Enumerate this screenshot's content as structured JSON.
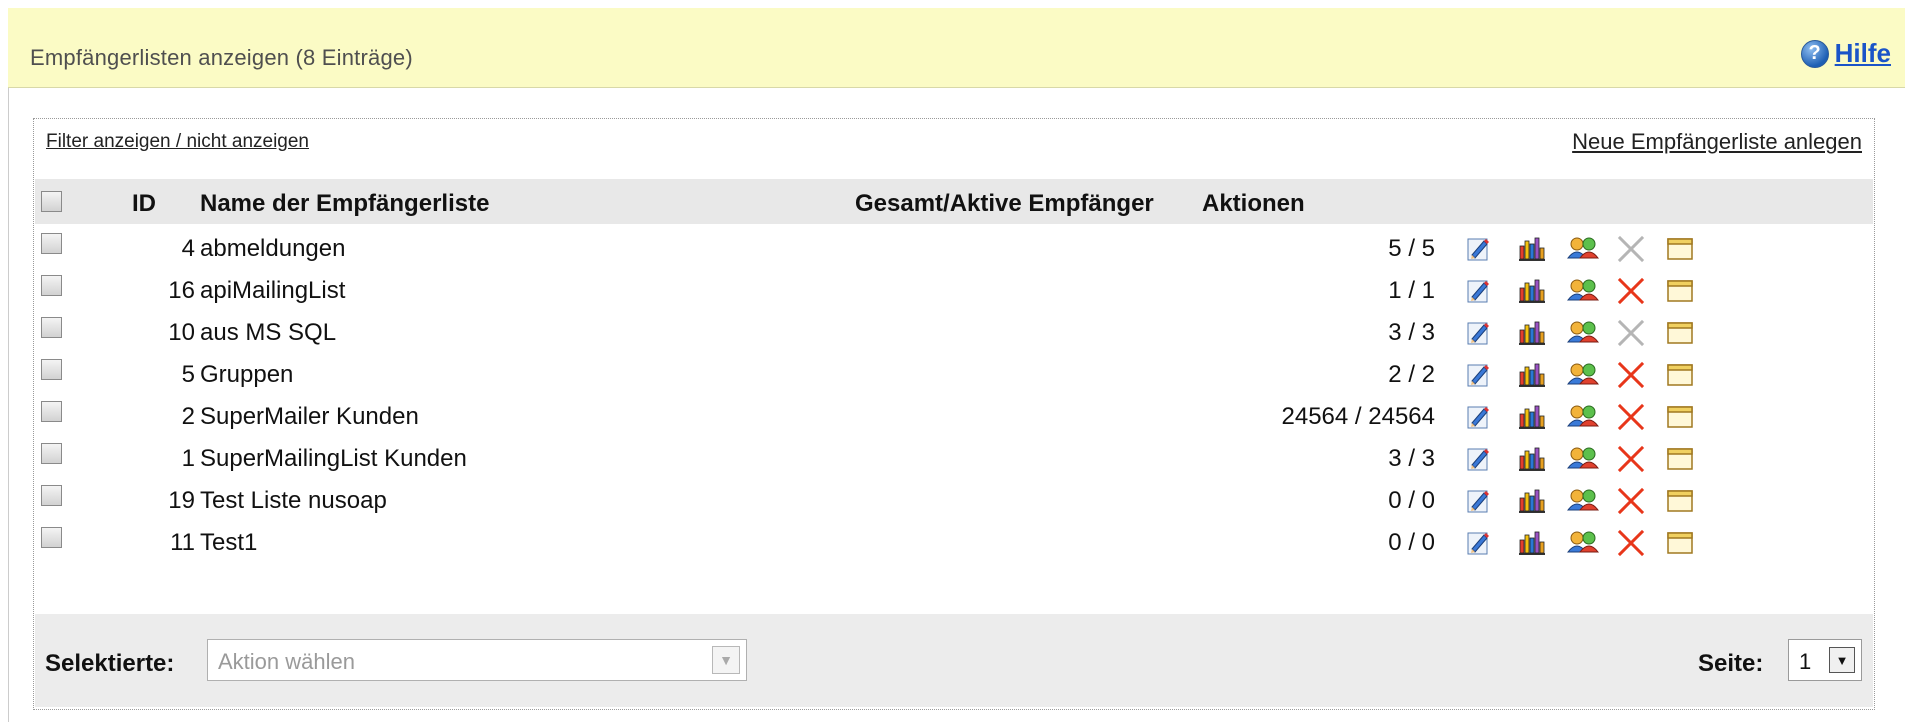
{
  "header": {
    "title": "Empfängerlisten anzeigen (8 Einträge)",
    "help_label": "Hilfe"
  },
  "toolbar": {
    "filter_link": "Filter anzeigen / nicht anzeigen",
    "new_link": "Neue Empfängerliste anlegen"
  },
  "table": {
    "columns": {
      "id": "ID",
      "name": "Name der Empfängerliste",
      "count": "Gesamt/Aktive Empfänger",
      "actions": "Aktionen"
    },
    "rows": [
      {
        "id": "4",
        "name": "abmeldungen",
        "count": "5 / 5",
        "delete_enabled": false
      },
      {
        "id": "16",
        "name": "apiMailingList",
        "count": "1 / 1",
        "delete_enabled": true
      },
      {
        "id": "10",
        "name": "aus MS SQL",
        "count": "3 / 3",
        "delete_enabled": false
      },
      {
        "id": "5",
        "name": "Gruppen",
        "count": "2 / 2",
        "delete_enabled": true
      },
      {
        "id": "2",
        "name": "SuperMailer Kunden",
        "count": "24564 / 24564",
        "delete_enabled": true
      },
      {
        "id": "1",
        "name": "SuperMailingList Kunden",
        "count": "3 / 3",
        "delete_enabled": true
      },
      {
        "id": "19",
        "name": "Test Liste nusoap",
        "count": "0 / 0",
        "delete_enabled": true
      },
      {
        "id": "11",
        "name": "Test1",
        "count": "0 / 0",
        "delete_enabled": true
      }
    ],
    "action_icons": [
      "edit-icon",
      "statistics-icon",
      "recipients-icon",
      "delete-icon",
      "properties-icon"
    ]
  },
  "footer": {
    "selected_label": "Selektierte:",
    "action_placeholder": "Aktion wählen",
    "page_label": "Seite:",
    "page_value": "1"
  },
  "colors": {
    "header_bg": "#fbfbc5",
    "table_header_bg": "#e8e8e8",
    "link": "#1a54c8",
    "delete_active": "#e8361a",
    "delete_disabled": "#b5b5b5"
  }
}
